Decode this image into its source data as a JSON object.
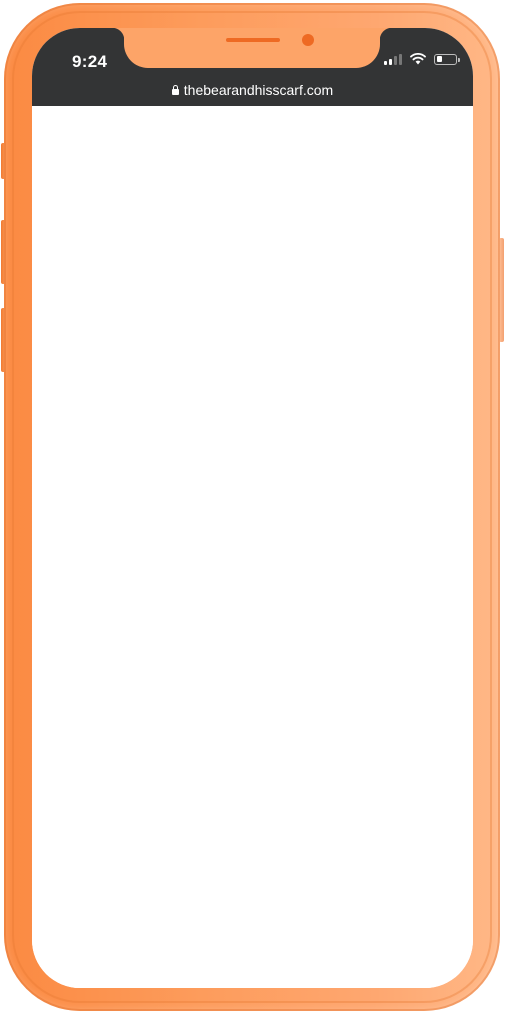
{
  "status_bar": {
    "time": "9:24",
    "signal_bars_active": 2,
    "signal_bars_total": 4,
    "battery_level": 0.35,
    "icons": [
      "signal-icon",
      "wifi-icon",
      "battery-icon"
    ]
  },
  "browser": {
    "url": "thebearandhisscarf.com",
    "secure_icon": "lock-icon"
  },
  "colors": {
    "frame": "#fd9c5c",
    "notch_accent": "#ee6a23",
    "status_bar_bg": "#333435",
    "screen_bg": "#ffffff"
  }
}
